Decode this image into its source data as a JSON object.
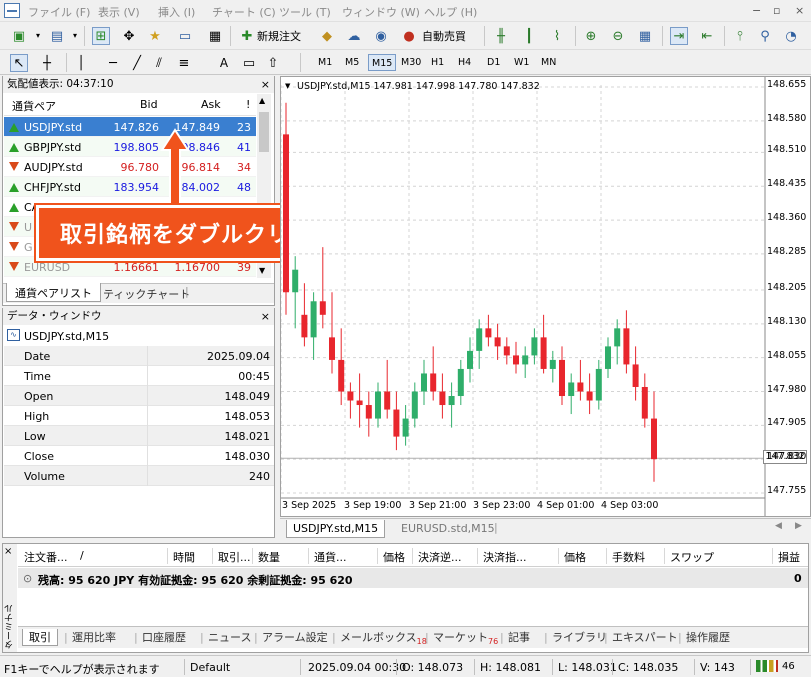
{
  "menu": {
    "items": [
      "ファイル (F)",
      "表示 (V)",
      "挿入 (I)",
      "チャート (C)",
      "ツール (T)",
      "ウィンドウ (W)",
      "ヘルプ (H)"
    ]
  },
  "toolbar": {
    "new_order": "新規注文",
    "auto_trade": "自動売買",
    "timeframes": [
      "M1",
      "M5",
      "M15",
      "M30",
      "H1",
      "H4",
      "D1",
      "W1",
      "MN"
    ],
    "active_timeframe": "M15"
  },
  "market_watch": {
    "title": "気配値表示: 04:37:10",
    "headers": {
      "symbol": "通貨ペア",
      "bid": "Bid",
      "ask": "Ask",
      "spread": "!"
    },
    "rows": [
      {
        "symbol": "USDJPY.std",
        "bid": "147.826",
        "ask": "147.849",
        "spread": "23",
        "dir": "up",
        "selected": true
      },
      {
        "symbol": "GBPJPY.std",
        "bid": "198.805",
        "ask": "198.846",
        "spread": "41",
        "dir": "up"
      },
      {
        "symbol": "AUDJPY.std",
        "bid": "96.780",
        "ask": "96.814",
        "spread": "34",
        "dir": "down"
      },
      {
        "symbol": "CHFJPY.std",
        "bid": "183.954",
        "ask": "184.002",
        "spread": "48",
        "dir": "up"
      },
      {
        "symbol": "CADJPY.std",
        "bid": "107.155",
        "ask": "107.202",
        "spread": "47",
        "dir": "up"
      },
      {
        "symbol": "U",
        "bid": "",
        "ask": "",
        "spread": "",
        "dir": "down"
      },
      {
        "symbol": "G",
        "bid": "",
        "ask": "",
        "spread": "",
        "dir": "down"
      },
      {
        "symbol": "EURUSD",
        "bid": "1.16661",
        "ask": "1.16700",
        "spread": "39",
        "dir": "down"
      }
    ],
    "tabs": [
      "通貨ペアリスト",
      "ティックチャート"
    ]
  },
  "callout": {
    "text": "取引銘柄をダブルクリックする"
  },
  "data_window": {
    "title": "データ・ウィンドウ",
    "symbol": "USDJPY.std,M15",
    "rows": [
      {
        "k": "Date",
        "v": "2025.09.04"
      },
      {
        "k": "Time",
        "v": "00:45"
      },
      {
        "k": "Open",
        "v": "148.049"
      },
      {
        "k": "High",
        "v": "148.053"
      },
      {
        "k": "Low",
        "v": "148.021"
      },
      {
        "k": "Close",
        "v": "148.030"
      },
      {
        "k": "Volume",
        "v": "240"
      }
    ]
  },
  "chart": {
    "header": "USDJPY.std,M15  147.981 147.998 147.780 147.832",
    "price_label": "147.832",
    "price_ticks": [
      "148.655",
      "148.580",
      "148.510",
      "148.435",
      "148.360",
      "148.285",
      "148.205",
      "148.130",
      "148.055",
      "147.980",
      "147.905",
      "147.830",
      "147.755"
    ],
    "time_ticks": [
      "3 Sep 2025",
      "3 Sep 19:00",
      "3 Sep 21:00",
      "3 Sep 23:00",
      "4 Sep 01:00",
      "4 Sep 03:00"
    ],
    "tabs": [
      "USDJPY.std,M15",
      "EURUSD.std,M15"
    ]
  },
  "chart_data": {
    "type": "candlestick",
    "symbol": "USDJPY.std",
    "timeframe": "M15",
    "ylim": [
      147.755,
      148.655
    ],
    "last": 147.832,
    "candles": [
      [
        148.55,
        148.62,
        148.15,
        148.2
      ],
      [
        148.2,
        148.28,
        148.12,
        148.25
      ],
      [
        148.15,
        148.22,
        148.08,
        148.1
      ],
      [
        148.1,
        148.2,
        148.05,
        148.18
      ],
      [
        148.18,
        148.3,
        148.12,
        148.15
      ],
      [
        148.1,
        148.2,
        148.02,
        148.05
      ],
      [
        148.05,
        148.12,
        147.95,
        147.98
      ],
      [
        147.98,
        148.0,
        147.92,
        147.96
      ],
      [
        147.96,
        148.02,
        147.9,
        147.95
      ],
      [
        147.95,
        147.98,
        147.88,
        147.92
      ],
      [
        147.92,
        148.0,
        147.9,
        147.98
      ],
      [
        147.98,
        148.05,
        147.92,
        147.94
      ],
      [
        147.94,
        147.98,
        147.85,
        147.88
      ],
      [
        147.88,
        147.95,
        147.86,
        147.92
      ],
      [
        147.92,
        148.0,
        147.9,
        147.98
      ],
      [
        147.98,
        148.05,
        147.95,
        148.02
      ],
      [
        148.02,
        148.08,
        147.96,
        147.98
      ],
      [
        147.98,
        148.02,
        147.92,
        147.95
      ],
      [
        147.95,
        148.0,
        147.9,
        147.97
      ],
      [
        147.97,
        148.05,
        147.95,
        148.03
      ],
      [
        148.03,
        148.1,
        148.0,
        148.07
      ],
      [
        148.07,
        148.14,
        148.03,
        148.12
      ],
      [
        148.12,
        148.15,
        148.08,
        148.1
      ],
      [
        148.1,
        148.13,
        148.05,
        148.08
      ],
      [
        148.08,
        148.1,
        148.04,
        148.06
      ],
      [
        148.06,
        148.09,
        148.02,
        148.04
      ],
      [
        148.04,
        148.08,
        148.01,
        148.06
      ],
      [
        148.06,
        148.12,
        148.04,
        148.1
      ],
      [
        148.1,
        148.15,
        148.02,
        148.03
      ],
      [
        148.03,
        148.07,
        148.0,
        148.05
      ],
      [
        148.05,
        148.08,
        147.95,
        147.97
      ],
      [
        147.97,
        148.02,
        147.93,
        148.0
      ],
      [
        148.0,
        148.05,
        147.96,
        147.98
      ],
      [
        147.98,
        148.02,
        147.93,
        147.96
      ],
      [
        147.96,
        148.05,
        147.94,
        148.03
      ],
      [
        148.03,
        148.1,
        148.01,
        148.08
      ],
      [
        148.08,
        148.14,
        148.04,
        148.12
      ],
      [
        148.12,
        148.16,
        148.02,
        148.04
      ],
      [
        148.04,
        148.08,
        147.96,
        147.99
      ],
      [
        147.99,
        148.02,
        147.9,
        147.92
      ],
      [
        147.92,
        147.98,
        147.78,
        147.83
      ]
    ]
  },
  "terminal": {
    "headers": [
      "注文番...",
      "/",
      "時間",
      "取引...",
      "数量",
      "通貨...",
      "価格",
      "決済逆...",
      "決済指...",
      "価格",
      "手数料",
      "スワップ",
      "損益"
    ],
    "balance_line": "残高: 95 620 JPY  有効証拠金: 95 620  余剰証拠金: 95 620",
    "balance_value": "0",
    "side_label": "ターミナル",
    "tabs": [
      "取引",
      "運用比率",
      "口座履歴",
      "ニュース",
      "アラーム設定",
      "メールボックス",
      "マーケット",
      "記事",
      "ライブラリ",
      "エキスパート",
      "操作履歴"
    ],
    "mail_badge": "18",
    "market_badge": "76"
  },
  "status": {
    "help": "F1キーでヘルプが表示されます",
    "profile": "Default",
    "datetime": "2025.09.04 00:30",
    "open": "O: 148.073",
    "high": "H: 148.081",
    "low": "L: 148.031",
    "close": "C: 148.035",
    "volume": "V: 143",
    "conn": "46"
  }
}
